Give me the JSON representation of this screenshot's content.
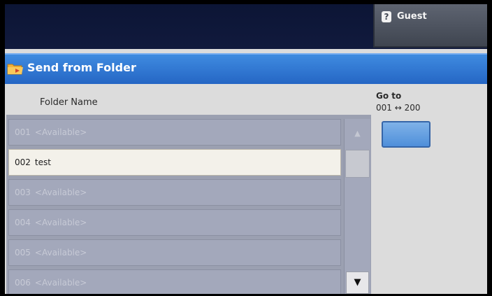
{
  "header": {
    "user_label": "Guest",
    "user_icon": "user-key-icon"
  },
  "title_bar": {
    "title": "Send from Folder",
    "icon": "folder-send-icon"
  },
  "list": {
    "column_header": "Folder Name",
    "rows": [
      {
        "number": "001",
        "name": "<Available>",
        "selected": false
      },
      {
        "number": "002",
        "name": "test",
        "selected": true
      },
      {
        "number": "003",
        "name": "<Available>",
        "selected": false
      },
      {
        "number": "004",
        "name": "<Available>",
        "selected": false
      },
      {
        "number": "005",
        "name": "<Available>",
        "selected": false
      },
      {
        "number": "006",
        "name": "<Available>",
        "selected": false
      }
    ],
    "scroll_up_symbol": "▲",
    "scroll_down_symbol": "▼"
  },
  "goto": {
    "label": "Go to",
    "range": "001 ↔ 200",
    "value": ""
  },
  "colors": {
    "title_bar": "#2f78d6",
    "selected_row": "#f3f1ea",
    "goto_button": "#6aa3e2"
  }
}
